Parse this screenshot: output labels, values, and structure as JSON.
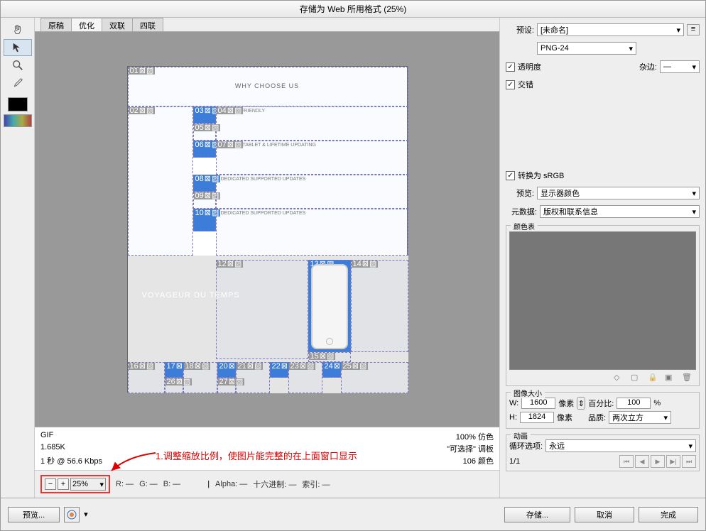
{
  "window": {
    "title": "存储为 Web 所用格式 (25%)"
  },
  "tabs": {
    "original": "原稿",
    "optimized": "优化",
    "twoup": "双联",
    "fourup": "四联"
  },
  "canvas": {
    "heading": "WHY CHOOSE US",
    "banner": "VOYAGEUR DU TEMPS",
    "sections": [
      "MOBILE FRIENDLY",
      "VIRTUAL TABLET & LIFETIME UPDATING",
      "DEDICATED SUPPORTED UPDATES",
      "DEDICATED SUPPORTED UPDATES"
    ]
  },
  "slices": {
    "s01": "01",
    "s02": "02",
    "s03": "03",
    "s04": "04",
    "s05": "05",
    "s06": "06",
    "s07": "07",
    "s08": "08",
    "s09": "09",
    "s10": "10",
    "s12": "12",
    "s13": "13",
    "s14": "14",
    "s15": "15",
    "s16": "16",
    "s17": "17",
    "s18": "18",
    "s20": "20",
    "s21": "21",
    "s22": "22",
    "s23": "23",
    "s24": "24",
    "s25": "25",
    "s26": "26",
    "s27": "27"
  },
  "info": {
    "format": "GIF",
    "size": "1.685K",
    "rate": "1 秒 @ 56.6 Kbps",
    "dither": "100% 仿色",
    "palette": "\"可选择\"  调板",
    "colors": "106 颜色"
  },
  "annotation": {
    "text": "1.调整缩放比例，使图片能完整的在上面窗口显示"
  },
  "zoom": {
    "minus": "−",
    "plus": "+",
    "value": "25%",
    "r": "R:  —",
    "g": "G:  —",
    "b": "B:  —",
    "alpha": "Alpha:  —",
    "hex": "十六进制:  —",
    "index": "索引:  —"
  },
  "right": {
    "preset_label": "预设:",
    "preset_value": "[未命名]",
    "format": "PNG-24",
    "transparency": "透明度",
    "interlace": "交错",
    "matte_label": "杂边:",
    "matte_value": "—",
    "convert_srgb": "转换为 sRGB",
    "preview_label": "预览:",
    "preview_value": "显示器颜色",
    "metadata_label": "元数据:",
    "metadata_value": "版权和联系信息",
    "colortable": "颜色表",
    "imagesize": "图像大小",
    "w_label": "W:",
    "w_val": "1600",
    "h_label": "H:",
    "h_val": "1824",
    "px": "像素",
    "percent_label": "百分比:",
    "percent_val": "100",
    "percent_unit": "%",
    "quality_label": "品质:",
    "quality_val": "两次立方",
    "animation": "动画",
    "loop_label": "循环选项:",
    "loop_val": "永远",
    "frame": "1/1"
  },
  "footer": {
    "preview": "预览...",
    "save": "存储...",
    "cancel": "取消",
    "done": "完成"
  }
}
